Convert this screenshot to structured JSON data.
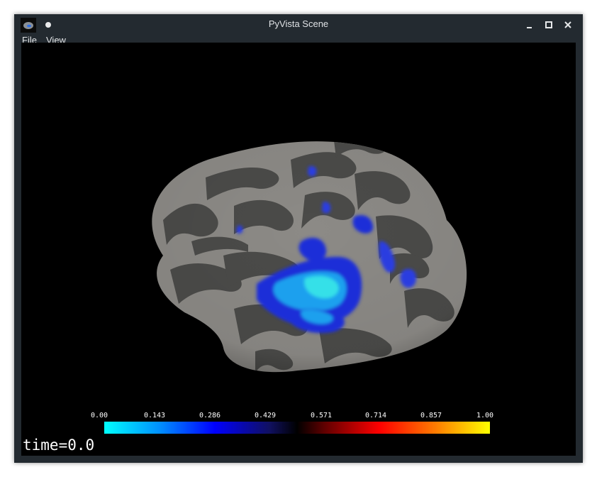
{
  "window": {
    "title": "PyVista Scene",
    "minimize_glyph": "–",
    "maximize_glyph": "□",
    "close_glyph": "✕",
    "icons": [
      "app-brain-icon",
      "pin-dot-icon",
      "minimize-icon",
      "maximize-icon",
      "close-icon"
    ]
  },
  "menubar": {
    "items": [
      "File",
      "View"
    ]
  },
  "scene": {
    "background": "#000000",
    "colorbar": {
      "ticks": [
        "0.00",
        "0.143",
        "0.286",
        "0.429",
        "0.571",
        "0.714",
        "0.857",
        "1.00"
      ],
      "colors": [
        "#00ffff",
        "#0000ff",
        "#000000",
        "#ff0000",
        "#ffff00"
      ]
    },
    "time_label": "time=0.0"
  }
}
